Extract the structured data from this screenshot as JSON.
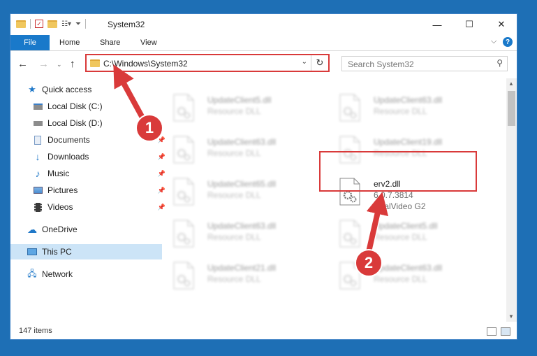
{
  "window": {
    "title": "System32",
    "controls": {
      "minimize": "—",
      "maximize": "☐",
      "close": "✕"
    }
  },
  "ribbon": {
    "tabs": [
      "File",
      "Home",
      "Share",
      "View"
    ],
    "expand": "⌵",
    "help": "?"
  },
  "address": {
    "path": "C:\\Windows\\System32",
    "search_placeholder": "Search System32"
  },
  "sidebar": {
    "items": [
      {
        "label": "Quick access",
        "icon": "star-icon"
      },
      {
        "label": "Local Disk (C:)",
        "icon": "drive-icon"
      },
      {
        "label": "Local Disk (D:)",
        "icon": "drive-icon"
      },
      {
        "label": "Documents",
        "icon": "documents-icon",
        "pinned": true
      },
      {
        "label": "Downloads",
        "icon": "download-icon",
        "pinned": true
      },
      {
        "label": "Music",
        "icon": "music-icon",
        "pinned": true
      },
      {
        "label": "Pictures",
        "icon": "pictures-icon",
        "pinned": true
      },
      {
        "label": "Videos",
        "icon": "videos-icon",
        "pinned": true
      },
      {
        "label": "OneDrive",
        "icon": "cloud-icon"
      },
      {
        "label": "This PC",
        "icon": "computer-icon",
        "selected": true
      },
      {
        "label": "Network",
        "icon": "network-icon"
      }
    ]
  },
  "files": [
    {
      "name": "UpdateClient5.dll",
      "desc": "Resource DLL",
      "blurred": true
    },
    {
      "name": "UpdateClient63.dll",
      "desc": "Resource DLL",
      "blurred": true
    },
    {
      "name": "UpdateClient63.dll",
      "desc": "Resource DLL",
      "blurred": true
    },
    {
      "name": "UpdateClient19.dll",
      "desc": "Resource DLL",
      "blurred": true
    },
    {
      "name": "UpdateClient65.dll",
      "desc": "Resource DLL",
      "blurred": true
    },
    {
      "name": "erv2.dll",
      "desc": "6.0.7.3814",
      "desc2": "RealVideo G2",
      "blurred": false
    },
    {
      "name": "UpdateClient63.dll",
      "desc": "Resource DLL",
      "blurred": true
    },
    {
      "name": "UpdateClient5.dll",
      "desc": "Resource DLL",
      "blurred": true
    },
    {
      "name": "UpdateClient21.dll",
      "desc": "Resource DLL",
      "blurred": true
    },
    {
      "name": "UpdateClient63.dll",
      "desc": "Resource DLL",
      "blurred": true
    }
  ],
  "status": {
    "item_count": "147 items"
  },
  "annotations": {
    "marker1": "1",
    "marker2": "2"
  },
  "colors": {
    "accent": "#1979ca",
    "annotation": "#d93a3a",
    "desktop": "#1e6fb5"
  }
}
